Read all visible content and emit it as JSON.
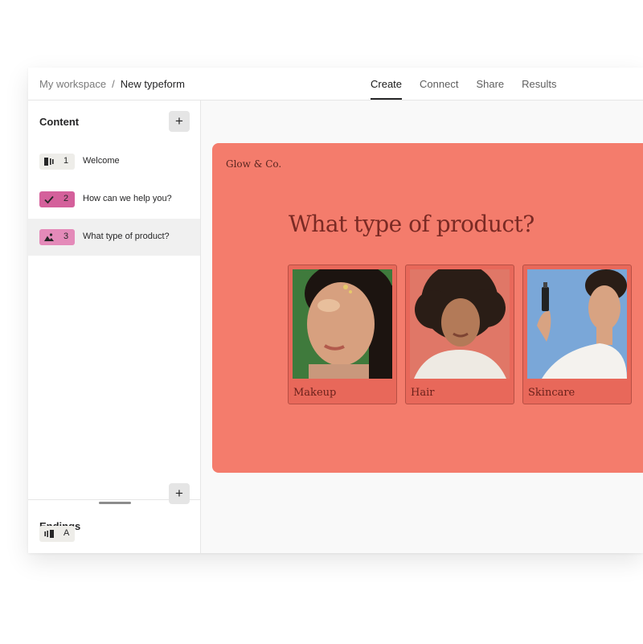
{
  "breadcrumb": {
    "workspace": "My workspace",
    "separator": "/",
    "current": "New typeform"
  },
  "tabs": [
    {
      "label": "Create",
      "active": true
    },
    {
      "label": "Connect",
      "active": false
    },
    {
      "label": "Share",
      "active": false
    },
    {
      "label": "Results",
      "active": false
    }
  ],
  "sidebar": {
    "content_title": "Content",
    "add_label": "+",
    "questions": [
      {
        "number": "1",
        "label": "Welcome",
        "icon": "welcome-screen-icon",
        "badge_color": "#eeede9"
      },
      {
        "number": "2",
        "label": "How can we help you?",
        "icon": "checkmark-icon",
        "badge_color": "#d4609b"
      },
      {
        "number": "3",
        "label": "What type of product?",
        "icon": "picture-choice-icon",
        "badge_color": "#e48ab9"
      }
    ],
    "endings_title": "Endings",
    "endings": [
      {
        "letter": "A",
        "icon": "ending-screen-icon",
        "badge_color": "#eeede9"
      }
    ]
  },
  "form": {
    "brand": "Glow & Co.",
    "question": "What type of product?",
    "background_color": "#f47c6c",
    "choices": [
      {
        "label": "Makeup",
        "image": "woman-with-glitter-makeup-photo"
      },
      {
        "label": "Hair",
        "image": "woman-with-curly-hair-photo"
      },
      {
        "label": "Skincare",
        "image": "man-spraying-face-mist-photo"
      }
    ]
  }
}
